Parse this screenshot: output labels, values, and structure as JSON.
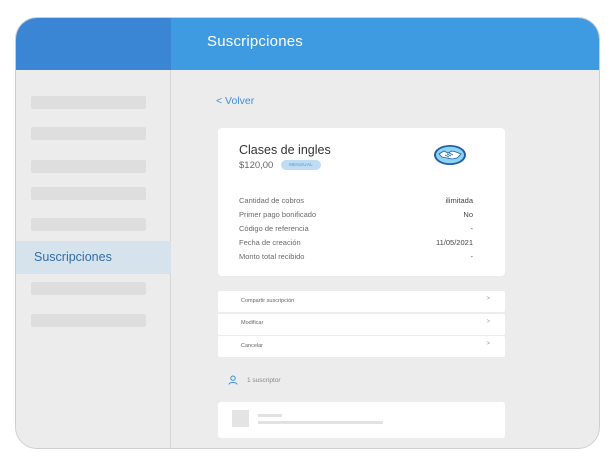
{
  "header": {
    "title": "Suscripciones"
  },
  "sidebar": {
    "active_item": "Suscripciones"
  },
  "back": {
    "label": "< Volver"
  },
  "subscription": {
    "title": "Clases de ingles",
    "price": "$120,00",
    "badge": "MENSUAL",
    "details": [
      {
        "label": "Cantidad de cobros",
        "value": "ilimitada"
      },
      {
        "label": "Primer pago bonificado",
        "value": "No"
      },
      {
        "label": "Código de referencia",
        "value": "-"
      },
      {
        "label": "Fecha de creación",
        "value": "11/05/2021"
      },
      {
        "label": "Monto total recibido",
        "value": "-"
      }
    ]
  },
  "actions": [
    {
      "label": "Compartir suscripción",
      "chevron": ">"
    },
    {
      "label": "Modificar",
      "chevron": ">"
    },
    {
      "label": "Cancelar",
      "chevron": ">"
    }
  ],
  "subscribers": {
    "label": "1 suscriptor",
    "icon": "user-icon"
  },
  "colors": {
    "header": "#3f9be1",
    "sidebar_top": "#3a86d4",
    "accent": "#3f8fd6",
    "active_bg": "#d6e2ec"
  }
}
